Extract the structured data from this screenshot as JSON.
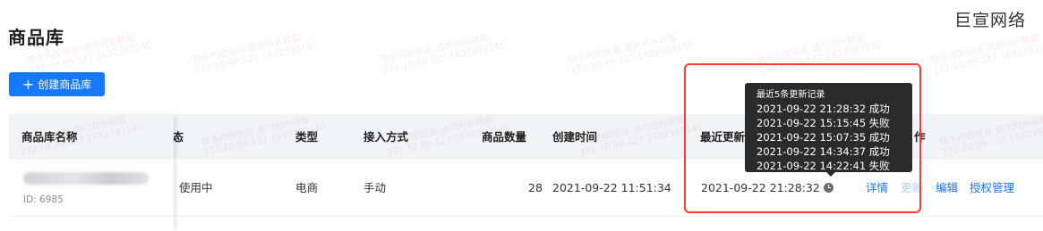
{
  "page": {
    "title": "商品库",
    "brand": "巨宣网络"
  },
  "toolbar": {
    "create_label": "创建商品库",
    "create_icon": "plus-icon"
  },
  "table": {
    "headers": {
      "name": "商品库名称",
      "status": "状态",
      "status_visible": "犬态",
      "type": "类型",
      "access": "接入方式",
      "count": "商品数量",
      "created": "创建时间",
      "updated": "最近更新时",
      "ops": "作"
    },
    "rows": [
      {
        "id": "ID: 6985",
        "status": "使用中",
        "type": "电商",
        "access": "手动",
        "count": "28",
        "created": "2021-09-22 11:51:34",
        "updated": "2021-09-22 21:28:32",
        "ops": {
          "detail": "详情",
          "update": "更新",
          "edit": "编辑",
          "auth": "授权管理"
        }
      }
    ]
  },
  "tooltip": {
    "title": "最近5条更新记录",
    "records": [
      "2021-09-22 21:28:32 成功",
      "2021-09-22 15:15:45 失败",
      "2021-09-22 15:07:35 成功",
      "2021-09-22 14:34:37 成功",
      "2021-09-22 14:22:41 失败"
    ]
  },
  "watermark": {
    "line1": "快手内部信息 请勿对外转载",
    "line2": "172.10.99.127 1632393140"
  },
  "colors": {
    "primary": "#1677ff",
    "highlight": "#ff3b30",
    "tooltip_bg": "#2b2b2b",
    "header_bg": "#f0f3f7"
  }
}
